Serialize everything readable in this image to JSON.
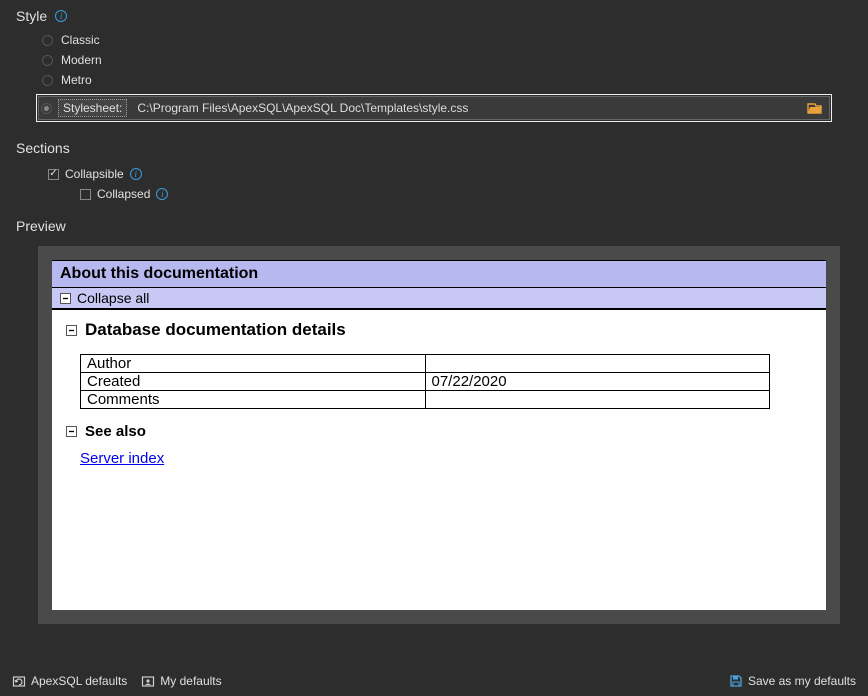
{
  "style": {
    "header": "Style",
    "options": [
      "Classic",
      "Modern",
      "Metro"
    ],
    "stylesheet_label": "Stylesheet:",
    "stylesheet_path": "C:\\Program Files\\ApexSQL\\ApexSQL Doc\\Templates\\style.css",
    "selected": "Stylesheet"
  },
  "sections": {
    "header": "Sections",
    "collapsible_label": "Collapsible",
    "collapsible_checked": true,
    "collapsed_label": "Collapsed",
    "collapsed_checked": false
  },
  "preview": {
    "header": "Preview",
    "doc_title": "About this documentation",
    "collapse_all": "Collapse all",
    "details_header": "Database documentation details",
    "table": {
      "rows": [
        {
          "label": "Author",
          "value": ""
        },
        {
          "label": "Created",
          "value": "07/22/2020"
        },
        {
          "label": "Comments",
          "value": ""
        }
      ]
    },
    "see_also_header": "See also",
    "server_link": "Server index"
  },
  "footer": {
    "apexsql_defaults": "ApexSQL defaults",
    "my_defaults": "My defaults",
    "save_defaults": "Save as my defaults"
  }
}
